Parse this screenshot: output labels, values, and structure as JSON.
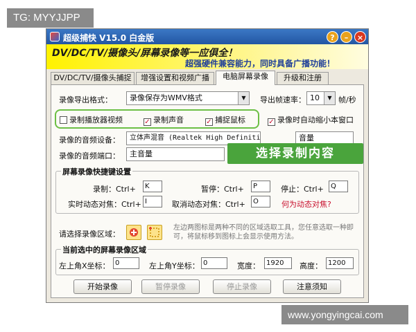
{
  "watermarks": {
    "top": "TG: MYYJJPP",
    "bottom": "www.yongyingcai.com"
  },
  "window": {
    "title": "超级捕快 V15.0 白金版"
  },
  "window_controls": {
    "help": "?",
    "minimize": "–",
    "close": "×"
  },
  "banner": {
    "line1": "DV/DC/TV/摄像头/屏幕录像等一应俱全！",
    "line2": "超强硬件兼容能力，同时具备广播功能！"
  },
  "tabs": [
    {
      "label": "DV/DC/TV/摄像头捕捉"
    },
    {
      "label": "增强设置和视频广播"
    },
    {
      "label": "电脑屏幕录像",
      "active": true
    },
    {
      "label": "升级和注册"
    }
  ],
  "format": {
    "label": "录像导出格式：",
    "value": "录像保存为WMV格式"
  },
  "fps": {
    "label": "导出帧速率：",
    "value": "10",
    "unit": "帧/秒"
  },
  "checkboxes": [
    {
      "label": "录制播放器视频",
      "checked": false
    },
    {
      "label": "录制声音",
      "checked": true
    },
    {
      "label": "捕捉鼠标",
      "checked": true
    },
    {
      "label": "录像时自动缩小本窗口",
      "checked": true
    }
  ],
  "check_mark": "✓",
  "audio_device": {
    "label": "录像的音频设备：",
    "value": "立体声混音 (Realtek High Definiti",
    "extra": "音量"
  },
  "audio_port": {
    "label": "录像的音频端口：",
    "value": "主音量"
  },
  "callout": "选择录制内容",
  "hotkeys": {
    "title": "屏幕录像快捷键设置",
    "record": {
      "label": "录制：Ctrl+",
      "value": "K"
    },
    "pause": {
      "label": "暂停：Ctrl+",
      "value": "P"
    },
    "stop": {
      "label": "停止：Ctrl+",
      "value": "Q"
    },
    "focus": {
      "label": "实时动态对焦：Ctrl+",
      "value": "I"
    },
    "cancel_focus": {
      "label": "取消动态对焦：Ctrl+",
      "value": "O"
    },
    "help_link": "何为动态对焦?"
  },
  "region_select": {
    "label": "请选择录像区域：",
    "hint": "左边两图标是两种不同的区域选取工具，您任意选取一种即可，将鼠标移到图标上会显示使用方法。"
  },
  "current_region": {
    "title": "当前选中的屏幕录像区域",
    "x": {
      "label": "左上角X坐标：",
      "value": "0"
    },
    "y": {
      "label": "左上角Y坐标：",
      "value": "0"
    },
    "width": {
      "label": "宽度：",
      "value": "1920"
    },
    "height": {
      "label": "高度：",
      "value": "1200"
    }
  },
  "buttons": {
    "start": "开始录像",
    "pause": "暂停录像",
    "stop": "停止录像",
    "notes": "注意须知"
  },
  "colors": {
    "title_bar": "#2e66b5",
    "banner": "#fff200",
    "callout": "#4aa43c",
    "highlight_frame": "#6cbf45",
    "link": "#c8102e"
  }
}
